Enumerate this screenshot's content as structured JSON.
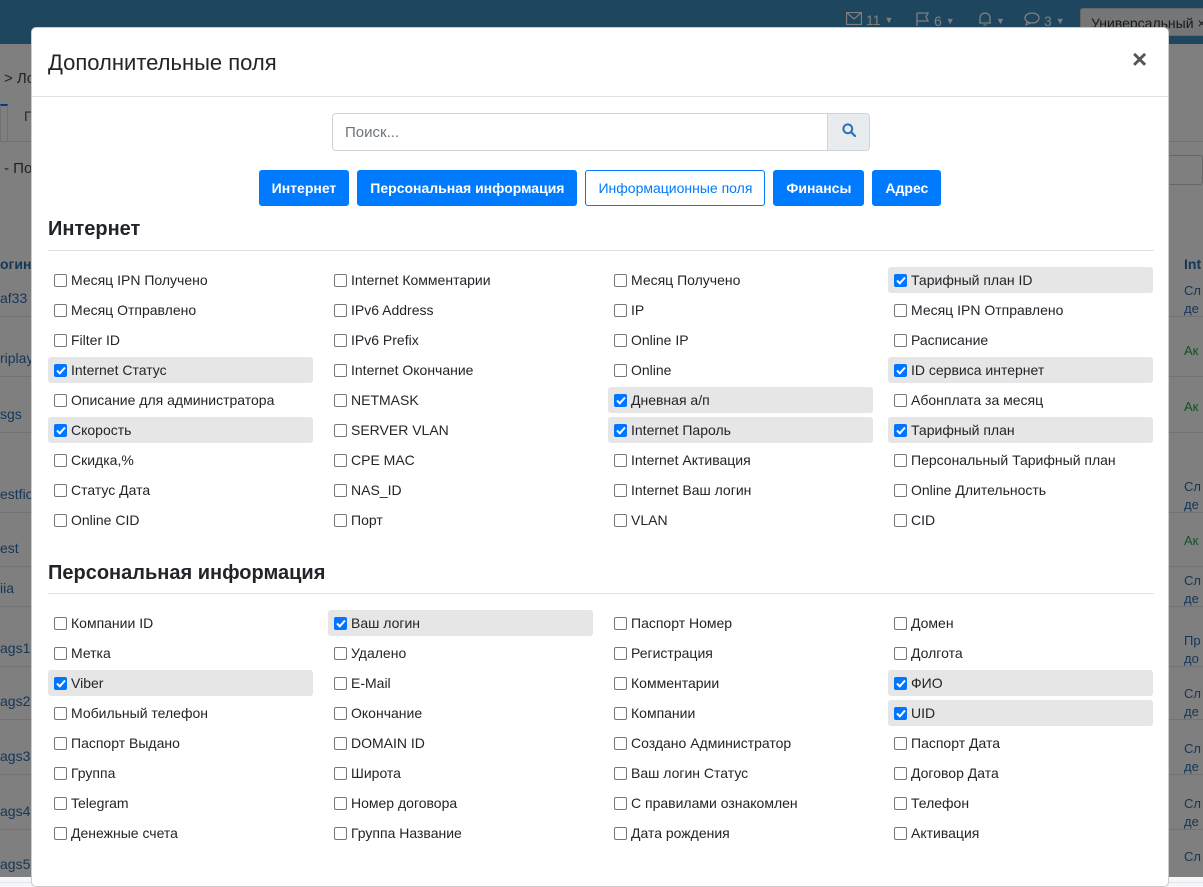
{
  "background": {
    "topbar": {
      "mail_count": "11",
      "flag_count": "6",
      "chat_count": "3",
      "universal_label": "Универсальный"
    },
    "breadcrumb_fragment": "> Ло",
    "tab_fragment": "П",
    "dash_fragment": "- По",
    "left_col_header": "огин",
    "right_col_header": "Int",
    "rows": [
      {
        "left": "af33",
        "right": "Сл\nде"
      },
      {
        "left": "riplay",
        "right": "Ак"
      },
      {
        "left": "sgs",
        "right": "Ак"
      },
      {
        "left": "estfio",
        "right": "Сл\nде"
      },
      {
        "left": "est",
        "right": "Ак"
      },
      {
        "left": "iia",
        "right": "Сл\nде"
      },
      {
        "left": "ags1",
        "right": "Пр\nдо"
      },
      {
        "left": "ags2",
        "right": "Сл\nде"
      },
      {
        "left": "ags3",
        "right": "Сл\nде"
      },
      {
        "left": "ags4",
        "right": "Сл\nде"
      },
      {
        "left": "ags5",
        "right": "Сл"
      }
    ]
  },
  "modal": {
    "title": "Дополнительные поля",
    "close_label": "×",
    "search": {
      "placeholder": "Поиск...",
      "value": ""
    },
    "filter_buttons": [
      {
        "label": "Интернет",
        "style": "primary"
      },
      {
        "label": "Персональная информация",
        "style": "primary"
      },
      {
        "label": "Информационные поля",
        "style": "outline"
      },
      {
        "label": "Финансы",
        "style": "primary"
      },
      {
        "label": "Адрес",
        "style": "primary"
      }
    ],
    "sections": [
      {
        "title": "Интернет",
        "items": [
          {
            "label": "Месяц IPN Получено",
            "checked": false
          },
          {
            "label": "Internet Комментарии",
            "checked": false
          },
          {
            "label": "Месяц Получено",
            "checked": false
          },
          {
            "label": "Тарифный план ID",
            "checked": true
          },
          {
            "label": "Месяц Отправлено",
            "checked": false
          },
          {
            "label": "IPv6 Address",
            "checked": false
          },
          {
            "label": "IP",
            "checked": false
          },
          {
            "label": "Месяц IPN Отправлено",
            "checked": false
          },
          {
            "label": "Filter ID",
            "checked": false
          },
          {
            "label": "IPv6 Prefix",
            "checked": false
          },
          {
            "label": "Online IP",
            "checked": false
          },
          {
            "label": "Расписание",
            "checked": false
          },
          {
            "label": "Internet Статус",
            "checked": true
          },
          {
            "label": "Internet Окончание",
            "checked": false
          },
          {
            "label": "Online",
            "checked": false
          },
          {
            "label": "ID сервиса интернет",
            "checked": true
          },
          {
            "label": "Описание для администратора",
            "checked": false
          },
          {
            "label": "NETMASK",
            "checked": false
          },
          {
            "label": "Дневная а/п",
            "checked": true
          },
          {
            "label": "Абонплата за месяц",
            "checked": false
          },
          {
            "label": "Скорость",
            "checked": true
          },
          {
            "label": "SERVER VLAN",
            "checked": false
          },
          {
            "label": "Internet Пароль",
            "checked": true
          },
          {
            "label": "Тарифный план",
            "checked": true
          },
          {
            "label": "Скидка,%",
            "checked": false
          },
          {
            "label": "CPE MAC",
            "checked": false
          },
          {
            "label": "Internet Активация",
            "checked": false
          },
          {
            "label": "Персональный Тарифный план",
            "checked": false
          },
          {
            "label": "Статус Дата",
            "checked": false
          },
          {
            "label": "NAS_ID",
            "checked": false
          },
          {
            "label": "Internet Ваш логин",
            "checked": false
          },
          {
            "label": "Online Длительность",
            "checked": false
          },
          {
            "label": "Online CID",
            "checked": false
          },
          {
            "label": "Порт",
            "checked": false
          },
          {
            "label": "VLAN",
            "checked": false
          },
          {
            "label": "CID",
            "checked": false
          }
        ]
      },
      {
        "title": "Персональная информация",
        "items": [
          {
            "label": "Компании ID",
            "checked": false
          },
          {
            "label": "Ваш логин",
            "checked": true
          },
          {
            "label": "Паспорт Номер",
            "checked": false
          },
          {
            "label": "Домен",
            "checked": false
          },
          {
            "label": "Метка",
            "checked": false
          },
          {
            "label": "Удалено",
            "checked": false
          },
          {
            "label": "Регистрация",
            "checked": false
          },
          {
            "label": "Долгота",
            "checked": false
          },
          {
            "label": "Viber",
            "checked": true
          },
          {
            "label": "E-Mail",
            "checked": false
          },
          {
            "label": "Комментарии",
            "checked": false
          },
          {
            "label": "ФИО",
            "checked": true
          },
          {
            "label": "Мобильный телефон",
            "checked": false
          },
          {
            "label": "Окончание",
            "checked": false
          },
          {
            "label": "Компании",
            "checked": false
          },
          {
            "label": "UID",
            "checked": true
          },
          {
            "label": "Паспорт Выдано",
            "checked": false
          },
          {
            "label": "DOMAIN ID",
            "checked": false
          },
          {
            "label": "Создано Администратор",
            "checked": false
          },
          {
            "label": "Паспорт Дата",
            "checked": false
          },
          {
            "label": "Группа",
            "checked": false
          },
          {
            "label": "Широта",
            "checked": false
          },
          {
            "label": "Ваш логин Статус",
            "checked": false
          },
          {
            "label": "Договор Дата",
            "checked": false
          },
          {
            "label": "Telegram",
            "checked": false
          },
          {
            "label": "Номер договора",
            "checked": false
          },
          {
            "label": "С правилами ознакомлен",
            "checked": false
          },
          {
            "label": "Телефон",
            "checked": false
          },
          {
            "label": "Денежные счета",
            "checked": false
          },
          {
            "label": "Группа Название",
            "checked": false
          },
          {
            "label": "Дата рождения",
            "checked": false
          },
          {
            "label": "Активация",
            "checked": false
          }
        ]
      }
    ]
  },
  "colors": {
    "primary": "#007bff",
    "checked_bg": "#e6e6e6",
    "checkbox_checked": "#0075ff",
    "topbar": "#3c8dbc"
  }
}
